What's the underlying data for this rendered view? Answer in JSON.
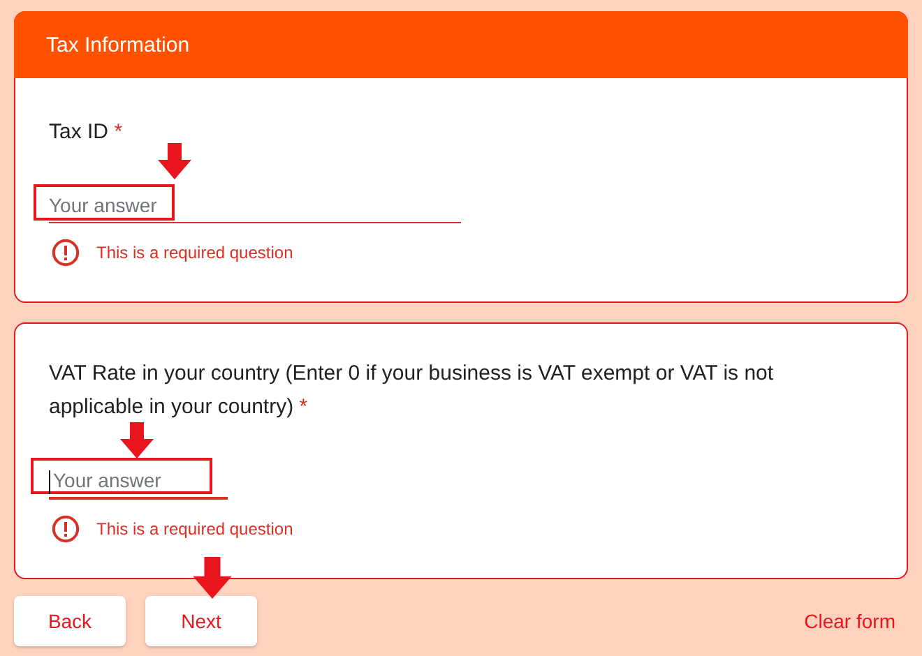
{
  "section": {
    "title": "Tax Information"
  },
  "questions": [
    {
      "label": "Tax ID",
      "required_mark": "*",
      "placeholder": "Your answer",
      "focused": false,
      "error": "This is a required question"
    },
    {
      "label": "VAT Rate in your country (Enter 0 if your business is VAT exempt or VAT is not applicable in your country)",
      "required_mark": "*",
      "placeholder": "Your answer",
      "focused": true,
      "error": "This is a required question"
    }
  ],
  "buttons": [
    {
      "label": "Back"
    },
    {
      "label": "Next"
    }
  ],
  "clear_link": "Clear form"
}
